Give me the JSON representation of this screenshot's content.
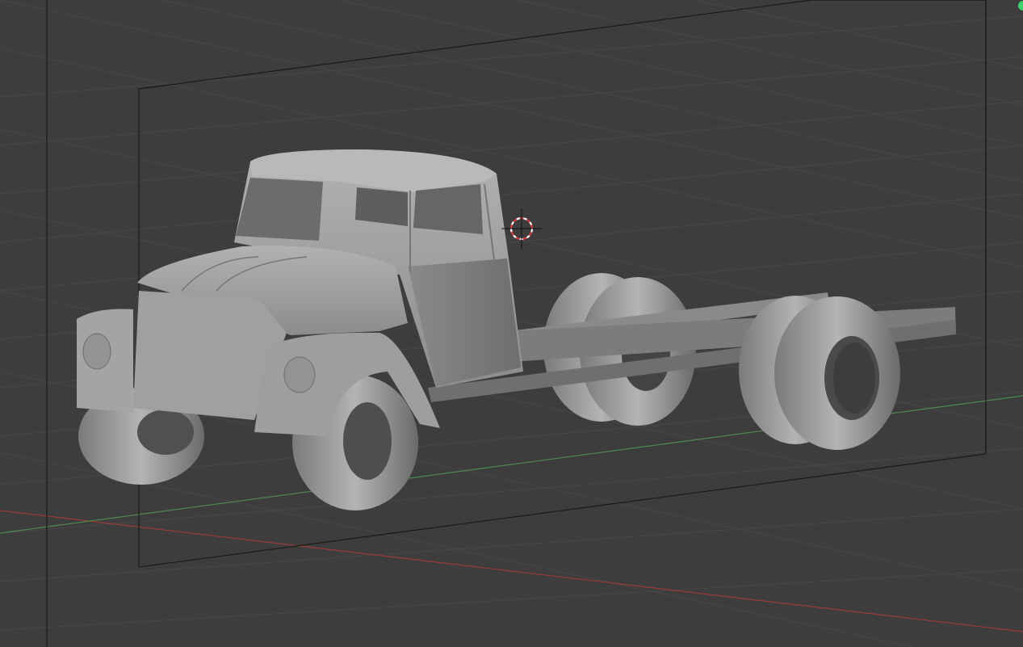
{
  "viewport": {
    "kind": "blender-3d-viewport",
    "shading": "solid",
    "background_color": "#3d3d3d",
    "grid_color": "#474747",
    "axis_x_color": "#9b3a3a",
    "axis_y_color": "#4e8a4e",
    "camera_frame_color": "#1a1a1a",
    "cursor_colors": [
      "#d23c3c",
      "#ffffff"
    ],
    "model_color": "#9a9a9a",
    "gizmo_color": "#3fd36b"
  },
  "scene": {
    "object": "truck-cab-chassis",
    "parts": [
      "cab",
      "hood",
      "fenders",
      "headlights",
      "frame-rails",
      "front-wheels",
      "rear-dual-wheels"
    ]
  }
}
